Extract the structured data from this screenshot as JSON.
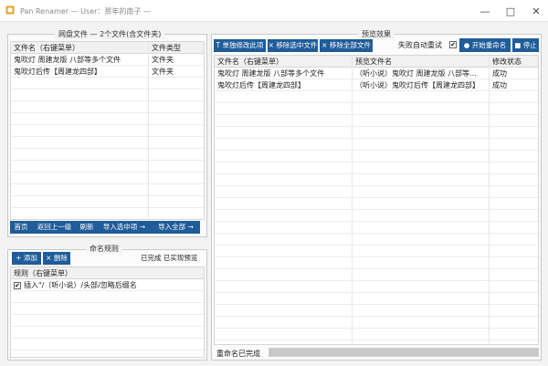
{
  "window": {
    "app_name": "Pan Renamer",
    "user_prefix": "User：",
    "user_name": "那年的南子",
    "title_sep1": " — ",
    "title_sep2": " — ",
    "minimize": "—",
    "maximize": "□",
    "close": "✕"
  },
  "cloud": {
    "title": "网盘文件 — 2个文件(含文件夹)",
    "columns": [
      "文件名（右键菜单）",
      "文件类型"
    ],
    "rows": [
      {
        "name": "鬼吹灯 周建龙版 八部等多个文件",
        "type": "文件夹"
      },
      {
        "name": "鬼吹灯后传【周建龙四部】",
        "type": "文件夹"
      }
    ],
    "buttons": {
      "home": "首页",
      "up": "返回上一级",
      "refresh": "刷新",
      "import_selected": "导入选中项 →",
      "import_all": "导入全部 →"
    }
  },
  "rules": {
    "title": "命名规则",
    "add": "+ 添加",
    "delete": "× 删除",
    "status": "已完成 已实现预览",
    "column": "规则（右键菜单）",
    "items": [
      {
        "checked": true,
        "check_mark": "✔",
        "label": "插入\"/（听小说）/头部/忽略后缀名"
      }
    ]
  },
  "preview": {
    "title": "预览效果",
    "btn_modify": "T 单独修改此项",
    "btn_remove_selected": "× 移除选中文件",
    "btn_remove_all": "× 移除全部文件",
    "retry_label": "失败自动重试",
    "retry_checked": true,
    "retry_mark": "✔",
    "start": "● 开始重命名",
    "stop": "■ 停止",
    "columns": [
      "文件名（右键菜单）",
      "预览文件名",
      "修改状态"
    ],
    "rows": [
      {
        "name": "鬼吹灯 周建龙版 八部等多个文件",
        "preview": "（听小说）鬼吹灯 周建龙版 八部等...",
        "status": "成功"
      },
      {
        "name": "鬼吹灯后传【周建龙四部】",
        "preview": "（听小说）鬼吹灯后传【周建龙四部】",
        "status": "成功"
      }
    ],
    "progress_text": "重命名已完成",
    "progress": 1.0
  },
  "colors": {
    "button_blue": "#1f5c99",
    "accent_icon": "#e8a020"
  }
}
